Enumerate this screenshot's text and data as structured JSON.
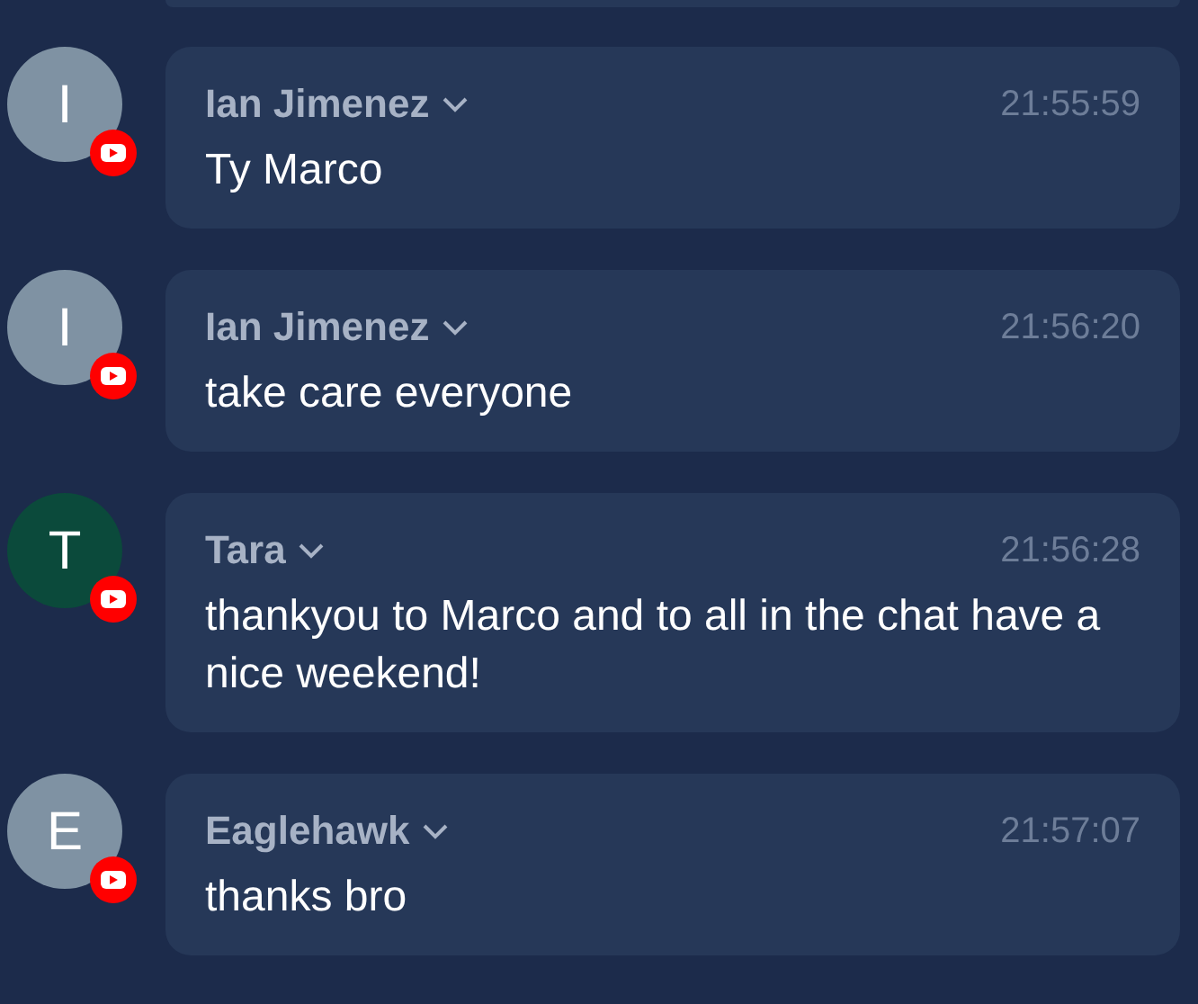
{
  "messages": [
    {
      "initial": "I",
      "color": "#7f92a3",
      "author": "Ian Jimenez",
      "time": "21:55:59",
      "text": "Ty Marco"
    },
    {
      "initial": "I",
      "color": "#7f92a3",
      "author": "Ian Jimenez",
      "time": "21:56:20",
      "text": "take care everyone"
    },
    {
      "initial": "T",
      "color": "#0b4a3b",
      "author": "Tara",
      "time": "21:56:28",
      "text": "thankyou to Marco and to all in the chat have a nice weekend!"
    },
    {
      "initial": "E",
      "color": "#7f92a3",
      "author": "Eaglehawk",
      "time": "21:57:07",
      "text": "thanks bro"
    }
  ]
}
